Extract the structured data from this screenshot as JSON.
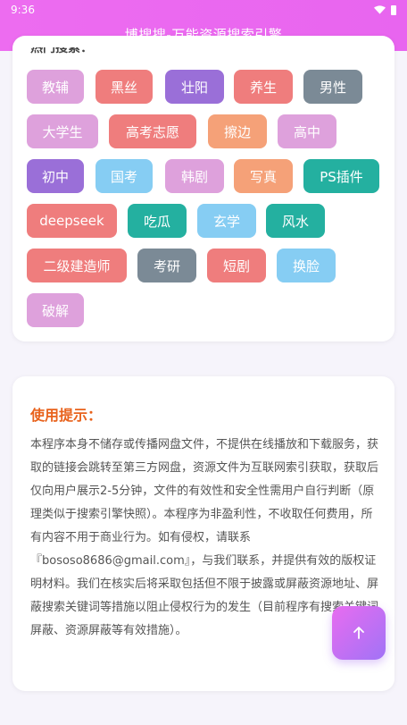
{
  "status_bar": {
    "time": "9:36"
  },
  "header": {
    "title": "博搜搜-万能资源搜索引擎"
  },
  "hot": {
    "heading": "热门搜索："
  },
  "tags": [
    {
      "label": "教辅",
      "color": "#dea1dc"
    },
    {
      "label": "黑丝",
      "color": "#ef7d7d"
    },
    {
      "label": "壮阳",
      "color": "#9a6fd8"
    },
    {
      "label": "养生",
      "color": "#ef7d7d"
    },
    {
      "label": "男性",
      "color": "#7b8a96"
    },
    {
      "label": "大学生",
      "color": "#dea1dc"
    },
    {
      "label": "高考志愿",
      "color": "#ef7d7d"
    },
    {
      "label": "擦边",
      "color": "#f5a178"
    },
    {
      "label": "高中",
      "color": "#dea1dc"
    },
    {
      "label": "初中",
      "color": "#9a6fd8"
    },
    {
      "label": "国考",
      "color": "#86cdf3"
    },
    {
      "label": "韩剧",
      "color": "#dea1dc"
    },
    {
      "label": "写真",
      "color": "#f5a178"
    },
    {
      "label": "PS插件",
      "color": "#24b0a0"
    },
    {
      "label": "deepseek",
      "color": "#ef7d7d"
    },
    {
      "label": "吃瓜",
      "color": "#24b0a0"
    },
    {
      "label": "玄学",
      "color": "#86cdf3"
    },
    {
      "label": "风水",
      "color": "#24b0a0"
    },
    {
      "label": "二级建造师",
      "color": "#ef7d7d"
    },
    {
      "label": "考研",
      "color": "#7b8a96"
    },
    {
      "label": "短剧",
      "color": "#ef7d7d"
    },
    {
      "label": "换脸",
      "color": "#86cdf3"
    },
    {
      "label": "破解",
      "color": "#dea1dc"
    }
  ],
  "notice": {
    "title": "使用提示：",
    "body": "本程序本身不储存或传播网盘文件，不提供在线播放和下载服务，获取的链接会跳转至第三方网盘，资源文件为互联网索引获取，获取后仅向用户展示2-5分钟，文件的有效性和安全性需用户自行判断（原理类似于搜索引擎快照）。本程序为非盈利性，不收取任何费用，所有内容不用于商业行为。如有侵权，请联系『bososo8686@gmail.com』，与我们联系，并提供有效的版权证明材料。我们在核实后将采取包括但不限于披露或屏蔽资源地址、屏蔽搜索关键词等措施以阻止侵权行为的发生（目前程序有搜索关键词屏蔽、资源屏蔽等有效措施）。"
  },
  "fab": {
    "icon": "arrow-up-icon"
  }
}
